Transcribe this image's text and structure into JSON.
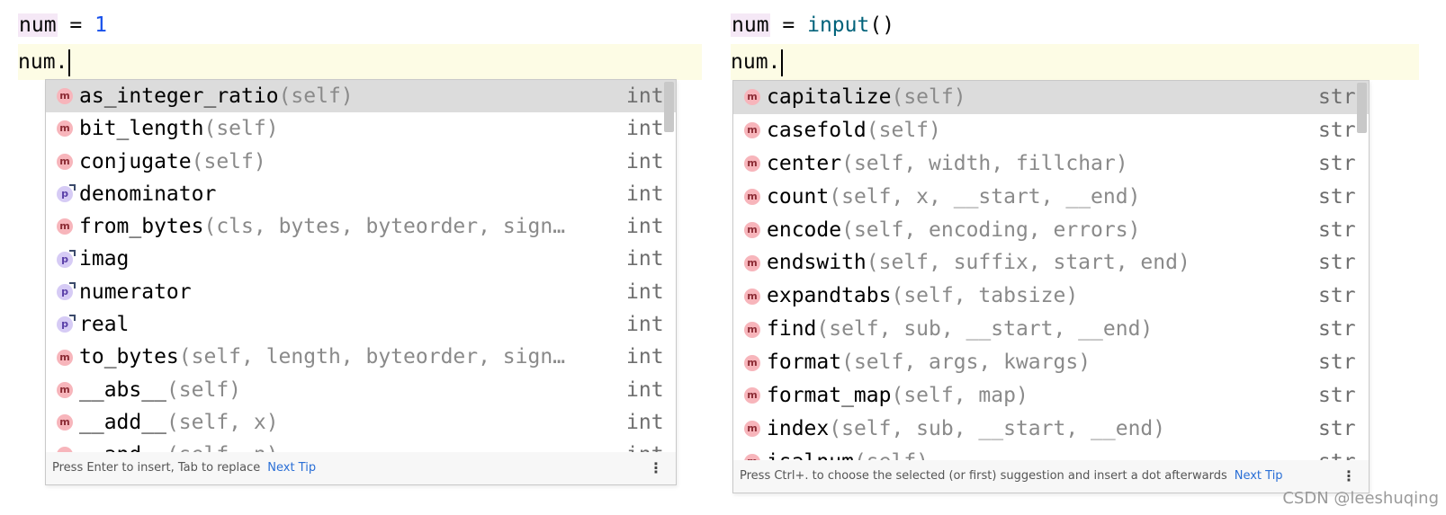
{
  "left": {
    "line1": {
      "var": "num",
      "op": " = ",
      "value": "1"
    },
    "line2": {
      "text": "num."
    },
    "popup": {
      "items": [
        {
          "kind": "m",
          "name": "as_integer_ratio",
          "params": "(self)",
          "type": "int",
          "selected": true
        },
        {
          "kind": "m",
          "name": "bit_length",
          "params": "(self)",
          "type": "int"
        },
        {
          "kind": "m",
          "name": "conjugate",
          "params": "(self)",
          "type": "int"
        },
        {
          "kind": "p",
          "name": "denominator",
          "params": "",
          "type": "int"
        },
        {
          "kind": "m",
          "name": "from_bytes",
          "params": "(cls, bytes, byteorder, sign…",
          "type": "int"
        },
        {
          "kind": "p",
          "name": "imag",
          "params": "",
          "type": "int"
        },
        {
          "kind": "p",
          "name": "numerator",
          "params": "",
          "type": "int"
        },
        {
          "kind": "p",
          "name": "real",
          "params": "",
          "type": "int"
        },
        {
          "kind": "m",
          "name": "to_bytes",
          "params": "(self, length, byteorder, sign…",
          "type": "int"
        },
        {
          "kind": "m",
          "name": "__abs__",
          "params": "(self)",
          "type": "int"
        },
        {
          "kind": "m",
          "name": "__add__",
          "params": "(self, x)",
          "type": "int"
        },
        {
          "kind": "m",
          "name": "__and__",
          "params": "(self, n)",
          "type": "int"
        }
      ],
      "footer": {
        "text": "Press Enter to insert, Tab to replace",
        "link": "Next Tip",
        "more": "⋮"
      }
    }
  },
  "right": {
    "line1": {
      "var": "num",
      "op": " = ",
      "fn": "input",
      "parens": "()"
    },
    "line2": {
      "text": "num."
    },
    "popup": {
      "items": [
        {
          "kind": "m",
          "name": "capitalize",
          "params": "(self)",
          "type": "str",
          "selected": true
        },
        {
          "kind": "m",
          "name": "casefold",
          "params": "(self)",
          "type": "str"
        },
        {
          "kind": "m",
          "name": "center",
          "params": "(self, width, fillchar)",
          "type": "str"
        },
        {
          "kind": "m",
          "name": "count",
          "params": "(self, x, __start, __end)",
          "type": "str"
        },
        {
          "kind": "m",
          "name": "encode",
          "params": "(self, encoding, errors)",
          "type": "str"
        },
        {
          "kind": "m",
          "name": "endswith",
          "params": "(self, suffix, start, end)",
          "type": "str"
        },
        {
          "kind": "m",
          "name": "expandtabs",
          "params": "(self, tabsize)",
          "type": "str"
        },
        {
          "kind": "m",
          "name": "find",
          "params": "(self, sub, __start, __end)",
          "type": "str"
        },
        {
          "kind": "m",
          "name": "format",
          "params": "(self, args, kwargs)",
          "type": "str"
        },
        {
          "kind": "m",
          "name": "format_map",
          "params": "(self, map)",
          "type": "str"
        },
        {
          "kind": "m",
          "name": "index",
          "params": "(self, sub, __start, __end)",
          "type": "str"
        },
        {
          "kind": "m",
          "name": "isalnum",
          "params": "(self)",
          "type": "str"
        }
      ],
      "footer": {
        "text": "Press Ctrl+. to choose the selected (or first) suggestion and insert a dot afterwards",
        "link": "Next Tip",
        "more": "⋮"
      }
    }
  },
  "watermark": "CSDN @leeshuqing"
}
